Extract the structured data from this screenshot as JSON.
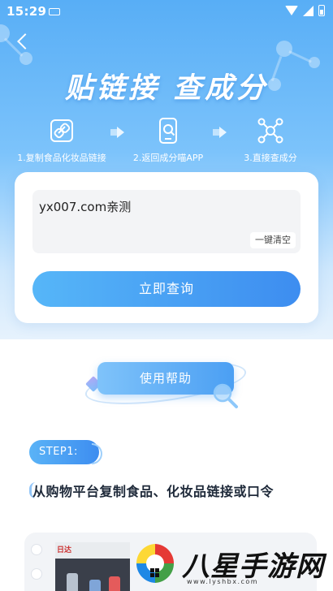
{
  "status_bar": {
    "time": "15:29",
    "icons": [
      "keyboard-icon",
      "wifi-icon",
      "signal-icon",
      "battery-icon"
    ]
  },
  "header": {
    "back_icon": "chevron-left-icon",
    "title": "贴链接 查成分"
  },
  "steps": [
    {
      "icon": "link-icon",
      "label": "1.复制食品化妆品链接"
    },
    {
      "icon": "phone-search-icon",
      "label": "2.返回成分喵APP"
    },
    {
      "icon": "molecule-icon",
      "label": "3.直接查成分"
    }
  ],
  "input_card": {
    "link_value": "yx007.com亲测",
    "clear_label": "一键清空",
    "query_label": "立即查询"
  },
  "help": {
    "button_label": "使用帮助"
  },
  "tutorial": {
    "step_badge": "STEP1:",
    "step_text": "从购物平台复制食品、化妆品链接或口令",
    "thumb_logo": "日达"
  },
  "watermark": {
    "text": "八星手游网",
    "url": "www.lyshbx.com"
  },
  "colors": {
    "accent": "#3d8df0",
    "hero_top": "#58aef6",
    "background": "#f4f6fa"
  }
}
